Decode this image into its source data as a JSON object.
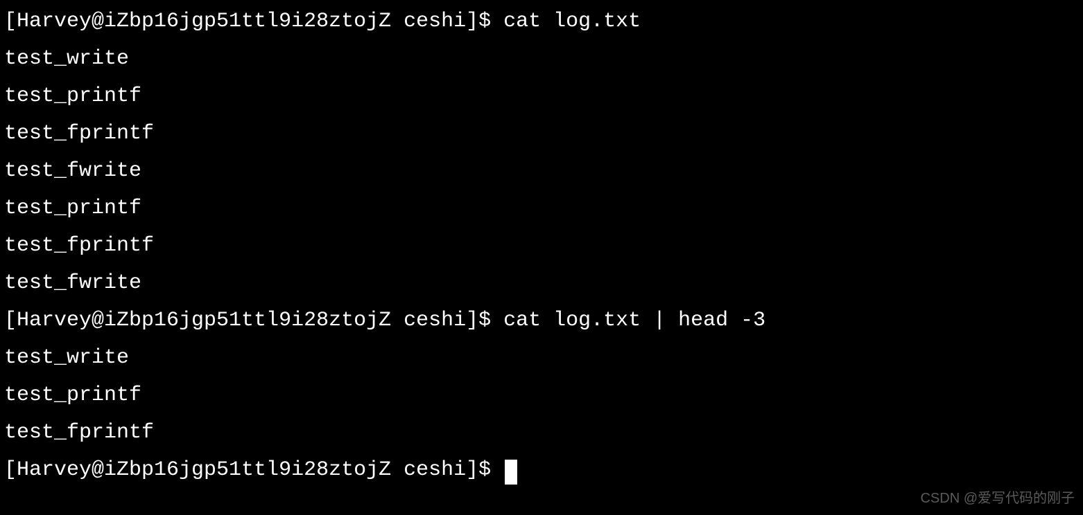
{
  "terminal": {
    "lines": [
      {
        "type": "prompt-cmd",
        "prompt": "[Harvey@iZbp16jgp51ttl9i28ztojZ ceshi]$ ",
        "command": "cat log.txt"
      },
      {
        "type": "output",
        "text": "test_write"
      },
      {
        "type": "output",
        "text": "test_printf"
      },
      {
        "type": "output",
        "text": "test_fprintf"
      },
      {
        "type": "output",
        "text": "test_fwrite"
      },
      {
        "type": "output",
        "text": "test_printf"
      },
      {
        "type": "output",
        "text": "test_fprintf"
      },
      {
        "type": "output",
        "text": "test_fwrite"
      },
      {
        "type": "prompt-cmd",
        "prompt": "[Harvey@iZbp16jgp51ttl9i28ztojZ ceshi]$ ",
        "command": "cat log.txt | head -3"
      },
      {
        "type": "output",
        "text": "test_write"
      },
      {
        "type": "output",
        "text": "test_printf"
      },
      {
        "type": "output",
        "text": "test_fprintf"
      },
      {
        "type": "prompt-cursor",
        "prompt": "[Harvey@iZbp16jgp51ttl9i28ztojZ ceshi]$ "
      }
    ]
  },
  "watermark": "CSDN @爱写代码的刚子"
}
